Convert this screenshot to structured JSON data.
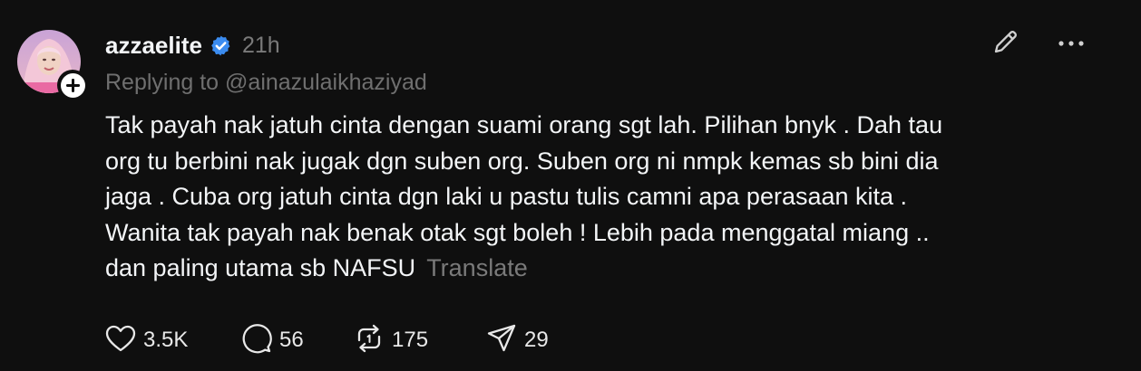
{
  "post": {
    "username": "azzaelite",
    "verified": true,
    "time": "21h",
    "reply_prefix": "Replying to",
    "reply_handle": "@ainazulaikhaziyad",
    "text_lines": [
      "Tak payah nak jatuh cinta dengan suami orang sgt lah. Pilihan bnyk . Dah tau",
      "org tu berbini nak jugak dgn suben org. Suben org ni nmpk kemas sb bini dia",
      "jaga . Cuba org jatuh cinta dgn laki u pastu tulis camni apa perasaan kita .",
      "Wanita tak payah nak benak otak sgt boleh ! Lebih pada menggatal miang ..",
      "dan paling utama sb NAFSU"
    ],
    "translate_label": "Translate"
  },
  "actions": {
    "likes": "3.5K",
    "comments": "56",
    "reposts": "175",
    "shares": "29"
  },
  "colors": {
    "background": "#0f0f0f",
    "text": "#f3f5f7",
    "muted": "#6f6f6f",
    "verified": "#3b8cf0"
  },
  "icons": {
    "edit": "pencil-icon",
    "more": "more-horizontal-icon",
    "like": "heart-icon",
    "comment": "comment-bubble-icon",
    "repost": "repost-icon",
    "share": "send-icon",
    "follow": "plus-icon",
    "verified": "verified-badge-icon"
  }
}
